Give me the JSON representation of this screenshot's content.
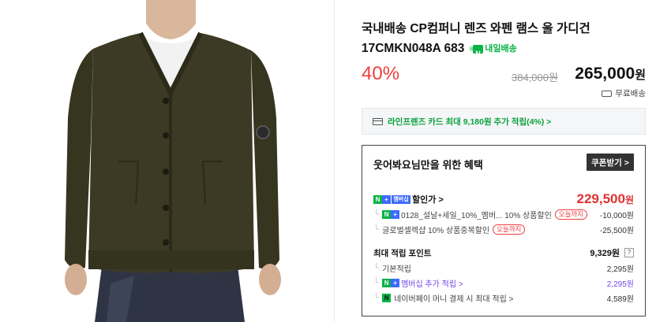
{
  "product": {
    "title": "국내배송 CP컴퍼니 렌즈 와펜 램스 울 가디건 17CMKN048A 683",
    "badge": "내일배송",
    "discount": "40%",
    "original_price": "384,000원",
    "sale_price": "265,000",
    "currency": "원",
    "shipping": "무료배송"
  },
  "card_banner": "라인프렌즈 카드 최대 9,180원 추가 적립(4%) >",
  "benefits": {
    "title": "웃어봐요님만을 위한 혜택",
    "coupon_button": "쿠폰받기 >",
    "coupon_price_label": "할인가 >",
    "coupon_price": "229,500",
    "membership_tag": "멤버십",
    "discount_rows": [
      {
        "label": "0128_설날+세일_10%_멤버... 10% 상품할인",
        "tag": "오늘까지",
        "amount": "-10,000원"
      },
      {
        "label": "글로벌셀렉샵 10% 상품중복할인",
        "tag": "오늘까지",
        "amount": "-25,500원"
      }
    ],
    "points_label": "최대 적립 포인트",
    "points_value": "9,329원",
    "points_help": "?",
    "point_rows": [
      {
        "label": "기본적립",
        "amount": "2,295원"
      },
      {
        "label": "멤버십 추가 적립 >",
        "amount": "2,295원"
      },
      {
        "label": "네이버페이 머니 결제 시 최대 적립 >",
        "amount": "4,589원"
      }
    ]
  },
  "colors": {
    "accent_red": "#f03e3e",
    "naver_green": "#08b445",
    "purple": "#7048e8"
  }
}
